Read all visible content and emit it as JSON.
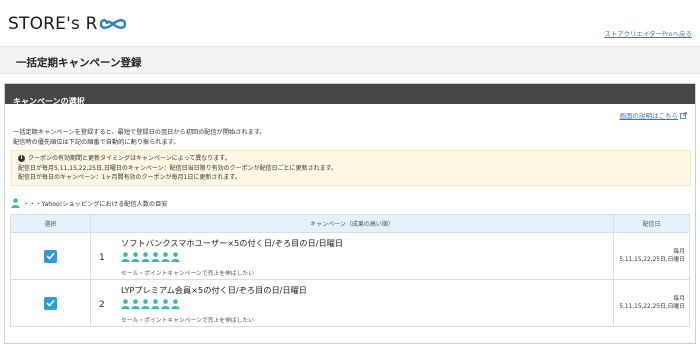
{
  "header": {
    "logo_text": "STORE's R",
    "back_link": "ストアクリエイターProへ戻る"
  },
  "page": {
    "title": "一括定期キャンペーン登録"
  },
  "panel": {
    "title": "キャンペーンの選択",
    "help_link": "画面の説明はこちら",
    "description": [
      "一括定期キャンペーンを登録すると、最短で登録日の翌日から初回の配信が開始されます。",
      "配信時の優先順位は下記の順番で自動的に割り振られます。"
    ],
    "notice": [
      "クーポンの有効期間と更新タイミングはキャンペーンによって異なります。",
      "配信日が毎月5,11,15,22,25日,日曜日のキャンペーン：配信日当日限り有効のクーポンが配信日ごとに更新されます。",
      "配信日が毎日のキャンペーン：1ヶ月間有効のクーポンが毎月1日に更新されます。"
    ],
    "legend_text": "・・・Yahoo!ショッピングにおける配信人数の目安"
  },
  "table": {
    "headers": {
      "select": "選択",
      "campaign": "キャンペーン（成果の高い順）",
      "delivery_date": "配信日"
    },
    "rows": [
      {
        "rank": "1",
        "title": "ソフトバンクスマホユーザー×5の付く日/ぞろ目の日/日曜日",
        "people_count": 6,
        "sub": "セール・ポイントキャンペーンで売上を伸ばしたい",
        "date_line1": "毎月",
        "date_line2": "5,11,15,22,25日,日曜日",
        "checked": true
      },
      {
        "rank": "2",
        "title": "LYPプレミアム会員×5の付く日/ぞろ目の日/日曜日",
        "people_count": 6,
        "sub": "セール・ポイントキャンペーンで売上を伸ばしたい",
        "date_line1": "毎月",
        "date_line2": "5,11,15,22,25日,日曜日",
        "checked": true
      }
    ]
  },
  "colors": {
    "accent": "#2d9bd8",
    "person": "#3cb8b4",
    "logo_loop": "#2a7fc7",
    "panel_header": "#464646"
  }
}
